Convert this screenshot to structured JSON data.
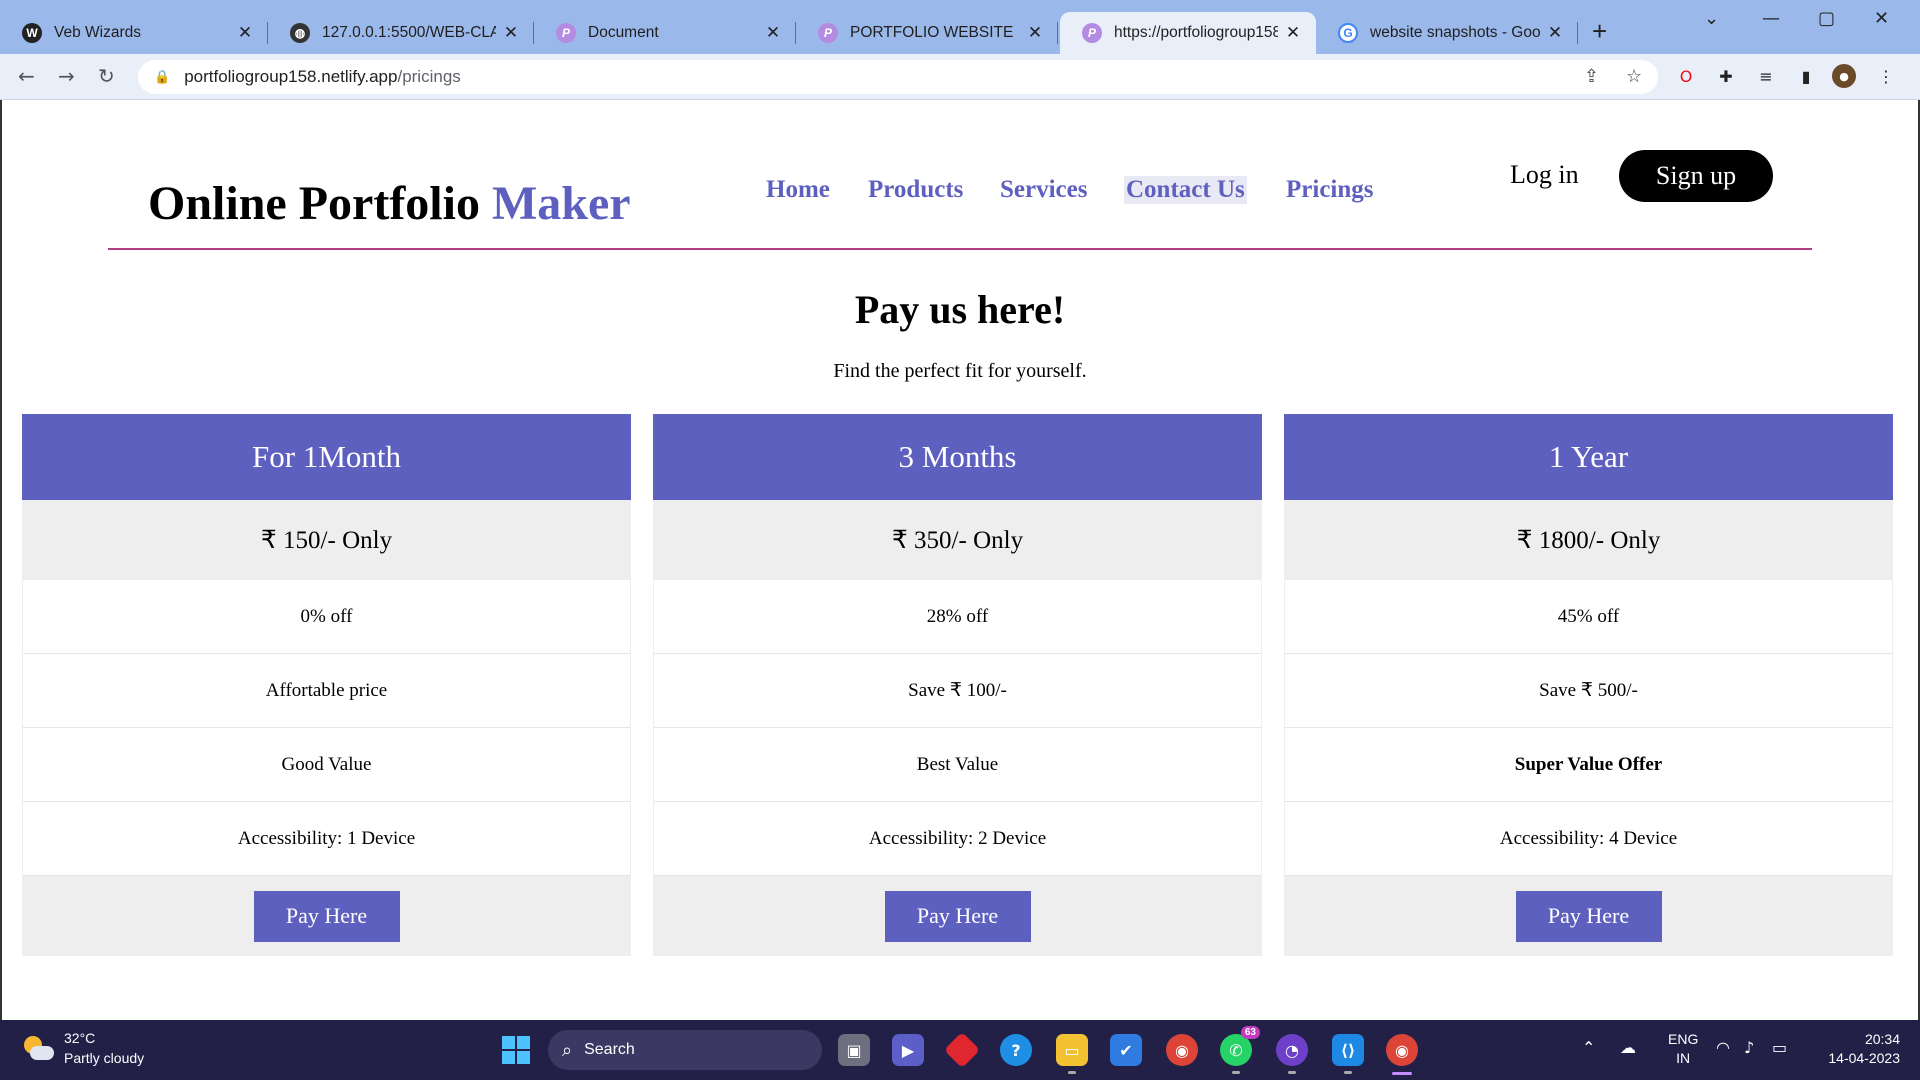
{
  "browser": {
    "tabs": [
      {
        "title": "Veb Wizards",
        "favicon": "veb-wizards-icon",
        "active": false
      },
      {
        "title": "127.0.0.1:5500/WEB-CLASH",
        "favicon": "globe-icon",
        "active": false
      },
      {
        "title": "Document",
        "favicon": "p-icon",
        "active": false
      },
      {
        "title": "PORTFOLIO WEBSITE",
        "favicon": "p-icon",
        "active": false
      },
      {
        "title": "https://portfoliogroup158.n",
        "favicon": "p-icon",
        "active": true
      },
      {
        "title": "website snapshots - Googl",
        "favicon": "google-icon",
        "active": false
      }
    ],
    "address": {
      "domain": "portfoliogroup158.netlify.app",
      "path": "/pricings"
    }
  },
  "site": {
    "brand_main": "Online Portfolio",
    "brand_accent": "Maker",
    "nav": [
      "Home",
      "Products",
      "Services",
      "Contact Us",
      "Pricings"
    ],
    "login": "Log in",
    "signup": "Sign up",
    "heading": "Pay us here!",
    "subheading": "Find the perfect fit for yourself."
  },
  "plans": [
    {
      "name": "For 1Month",
      "price": "₹ 150/- Only",
      "discount": "0% off",
      "note": "Affortable price",
      "value": "Good Value",
      "access": "Accessibility: 1 Device",
      "button": "Pay Here"
    },
    {
      "name": "3 Months",
      "price": "₹ 350/- Only",
      "discount": "28% off",
      "note": "Save ₹ 100/-",
      "value": "Best Value",
      "access": "Accessibility: 2 Device",
      "button": "Pay Here"
    },
    {
      "name": "1 Year",
      "price": "₹ 1800/- Only",
      "discount": "45% off",
      "note": "Save ₹ 500/-",
      "value": "Super Value Offer",
      "access": "Accessibility: 4 Device",
      "button": "Pay Here"
    }
  ],
  "taskbar": {
    "temperature": "32°C",
    "condition": "Partly cloudy",
    "search": "Search",
    "whatsapp_badge": "63",
    "lang_1": "ENG",
    "lang_2": "IN",
    "time": "20:34",
    "date": "14-04-2023"
  },
  "colors": {
    "accent": "#5e60c0",
    "divider": "#b23d82",
    "tabstrip": "#9bb8ea",
    "taskbar": "#232048"
  }
}
